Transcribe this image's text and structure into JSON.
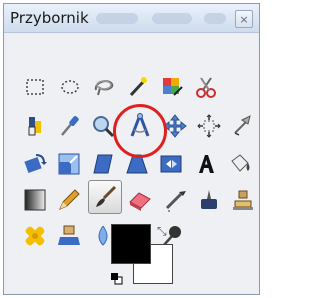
{
  "window": {
    "title": "Przybornik",
    "close_label": "×"
  },
  "toolbox": {
    "rows": [
      [
        "rect-select-icon",
        "ellipse-select-icon",
        "lasso-select-icon",
        "fuzzy-select-icon",
        "select-by-color-icon",
        "scissors-select-icon"
      ],
      [
        "foreground-select-icon",
        "paths-icon",
        "color-picker-icon",
        "zoom-icon",
        "measure-icon",
        "move-icon",
        "align-icon",
        "crop-icon"
      ],
      [
        "rotate-icon",
        "scale-icon",
        "shear-icon",
        "perspective-icon",
        "flip-icon",
        "text-icon",
        "bucket-fill-icon"
      ],
      [
        "blend-icon",
        "pencil-icon",
        "paintbrush-icon",
        "eraser-icon",
        "airbrush-icon",
        "ink-icon",
        "clone-icon"
      ],
      [
        "heal-icon",
        "perspective-clone-icon",
        "blur-icon",
        "smudge-icon",
        "dodge-burn-icon"
      ]
    ],
    "active_tool": "paintbrush-icon",
    "highlighted_tool": "measure-icon"
  },
  "colors": {
    "foreground": "#000000",
    "background": "#ffffff",
    "swap_glyph": "⤡"
  }
}
